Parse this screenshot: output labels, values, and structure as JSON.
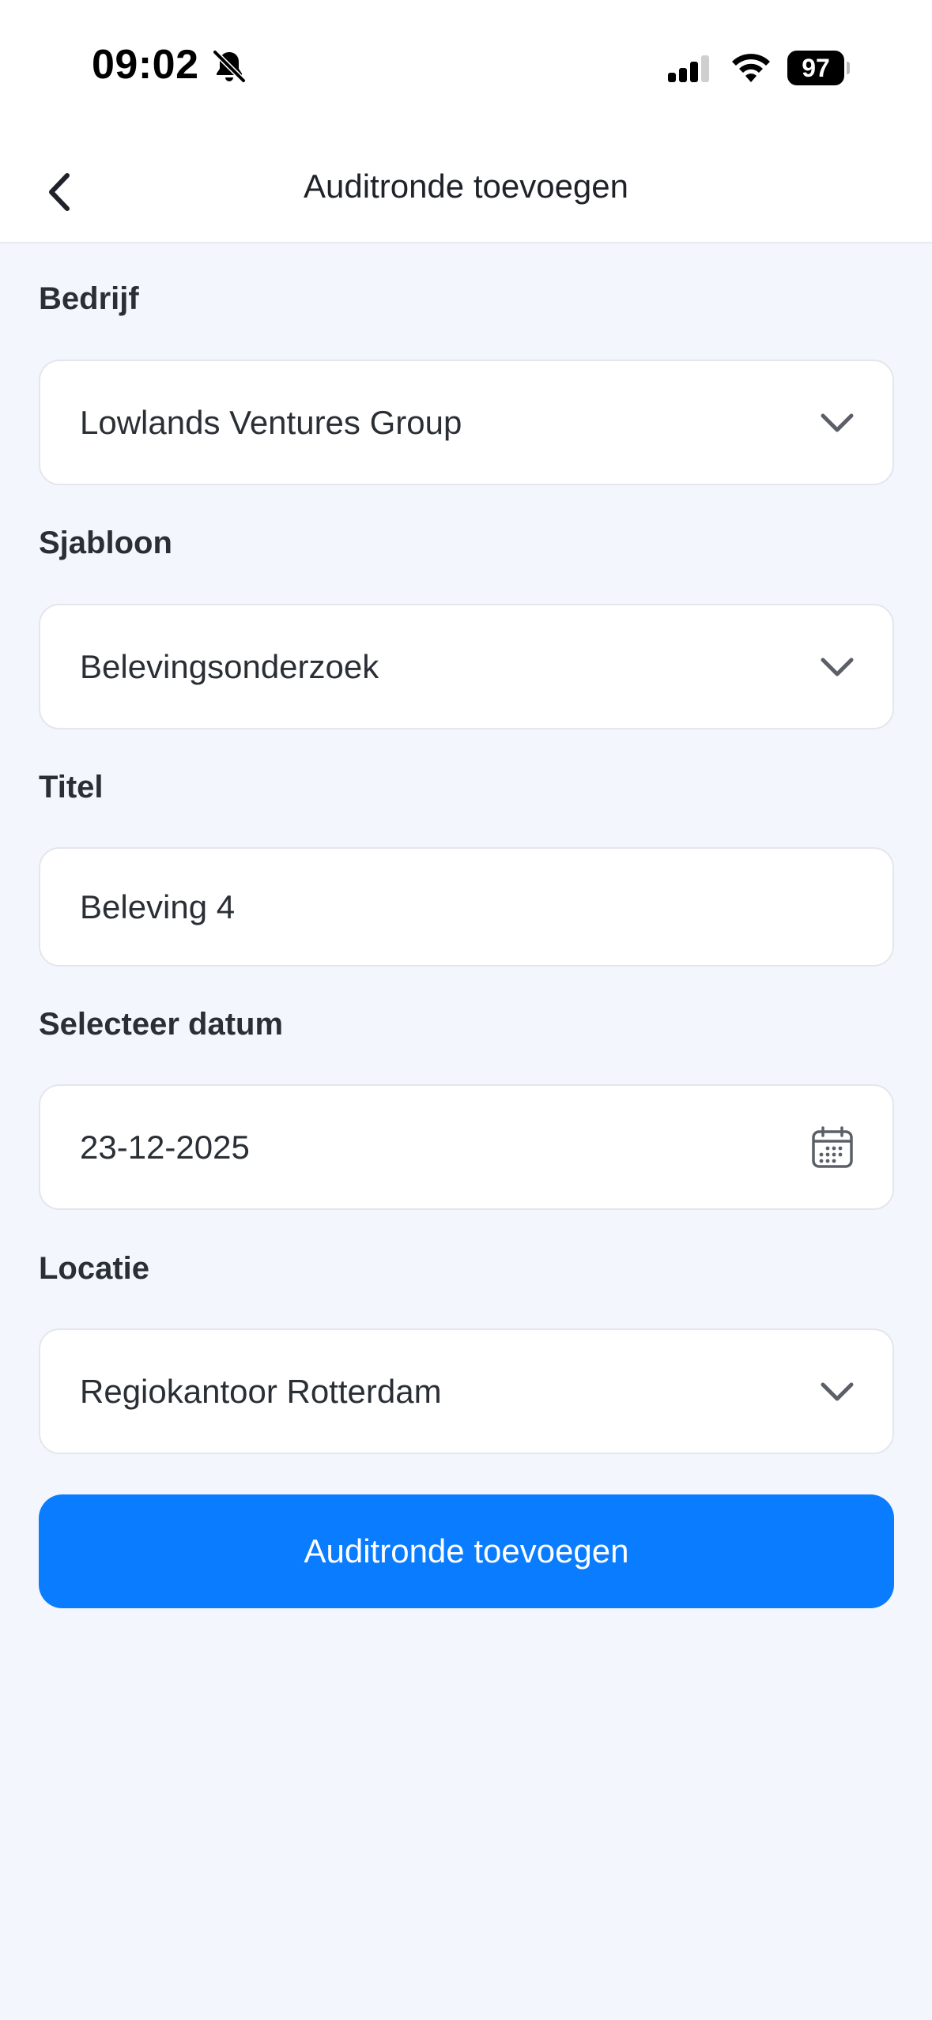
{
  "status_bar": {
    "time": "09:02",
    "battery": "97"
  },
  "nav": {
    "title": "Auditronde toevoegen"
  },
  "form": {
    "bedrijf": {
      "label": "Bedrijf",
      "value": "Lowlands Ventures Group"
    },
    "sjabloon": {
      "label": "Sjabloon",
      "value": "Belevingsonderzoek"
    },
    "titel": {
      "label": "Titel",
      "value": "Beleving 4"
    },
    "datum": {
      "label": "Selecteer datum",
      "value": "23-12-2025"
    },
    "locatie": {
      "label": "Locatie",
      "value": "Regiokantoor Rotterdam"
    },
    "submit_label": "Auditronde toevoegen"
  },
  "icons": {
    "back": "chevron-left-icon",
    "dropdown": "chevron-down-icon",
    "calendar": "calendar-icon",
    "bell": "bell-slash-icon"
  },
  "colors": {
    "accent": "#0a7cff",
    "background": "#f3f6fc",
    "surface": "#ffffff"
  }
}
